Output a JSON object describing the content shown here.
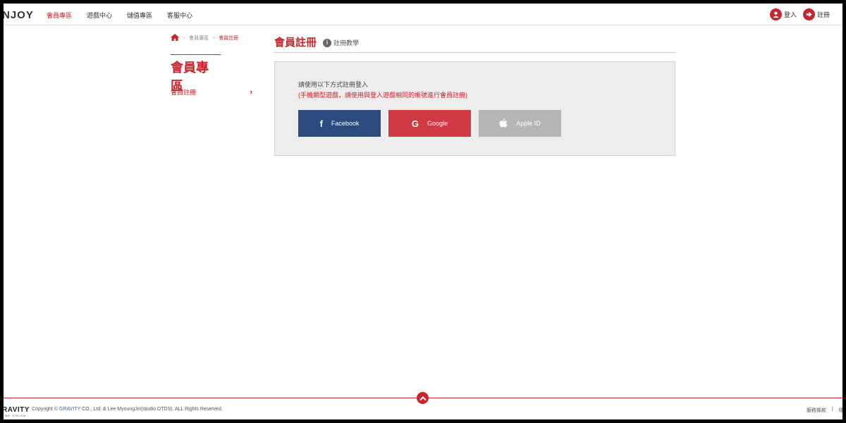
{
  "header": {
    "logo": "NJOY",
    "nav": [
      "會員專區",
      "遊戲中心",
      "儲值專區",
      "客服中心"
    ],
    "login": "登入",
    "register": "註冊"
  },
  "breadcrumb": {
    "items": [
      "會員專區",
      "會員註冊"
    ],
    "separator": ">"
  },
  "sidebar": {
    "title": "會員專區",
    "items": [
      {
        "label": "會員註冊"
      }
    ]
  },
  "main": {
    "title": "會員註冊",
    "tutorial_link": "註冊教學",
    "instruction": "請使用以下方式註冊登入",
    "note": "(手機類型遊戲，請使用與登入遊戲相同的帳號進行會員註冊)",
    "buttons": {
      "facebook": "Facebook",
      "google": "Google",
      "apple": "Apple ID"
    }
  },
  "footer": {
    "logo": "RAVITY",
    "logo_sub": "ME VISION",
    "copyright_prefix": "Copyright ©",
    "brand": "GRAVITY",
    "copyright_suffix": "CO., Ltd. & Lee MyoungJin(studio DTDS). ALL Rights Reserved.",
    "links": [
      "服務條款",
      "|",
      "隱私"
    ]
  },
  "colors": {
    "accent": "#c8252c",
    "facebook": "#2d4a7e",
    "google": "#d03a42",
    "apple": "#b5b5b5"
  },
  "icons": [
    "user-icon",
    "arrow-right-icon",
    "home-icon",
    "info-icon",
    "facebook-icon",
    "google-icon",
    "apple-icon",
    "chevron-up-icon"
  ]
}
